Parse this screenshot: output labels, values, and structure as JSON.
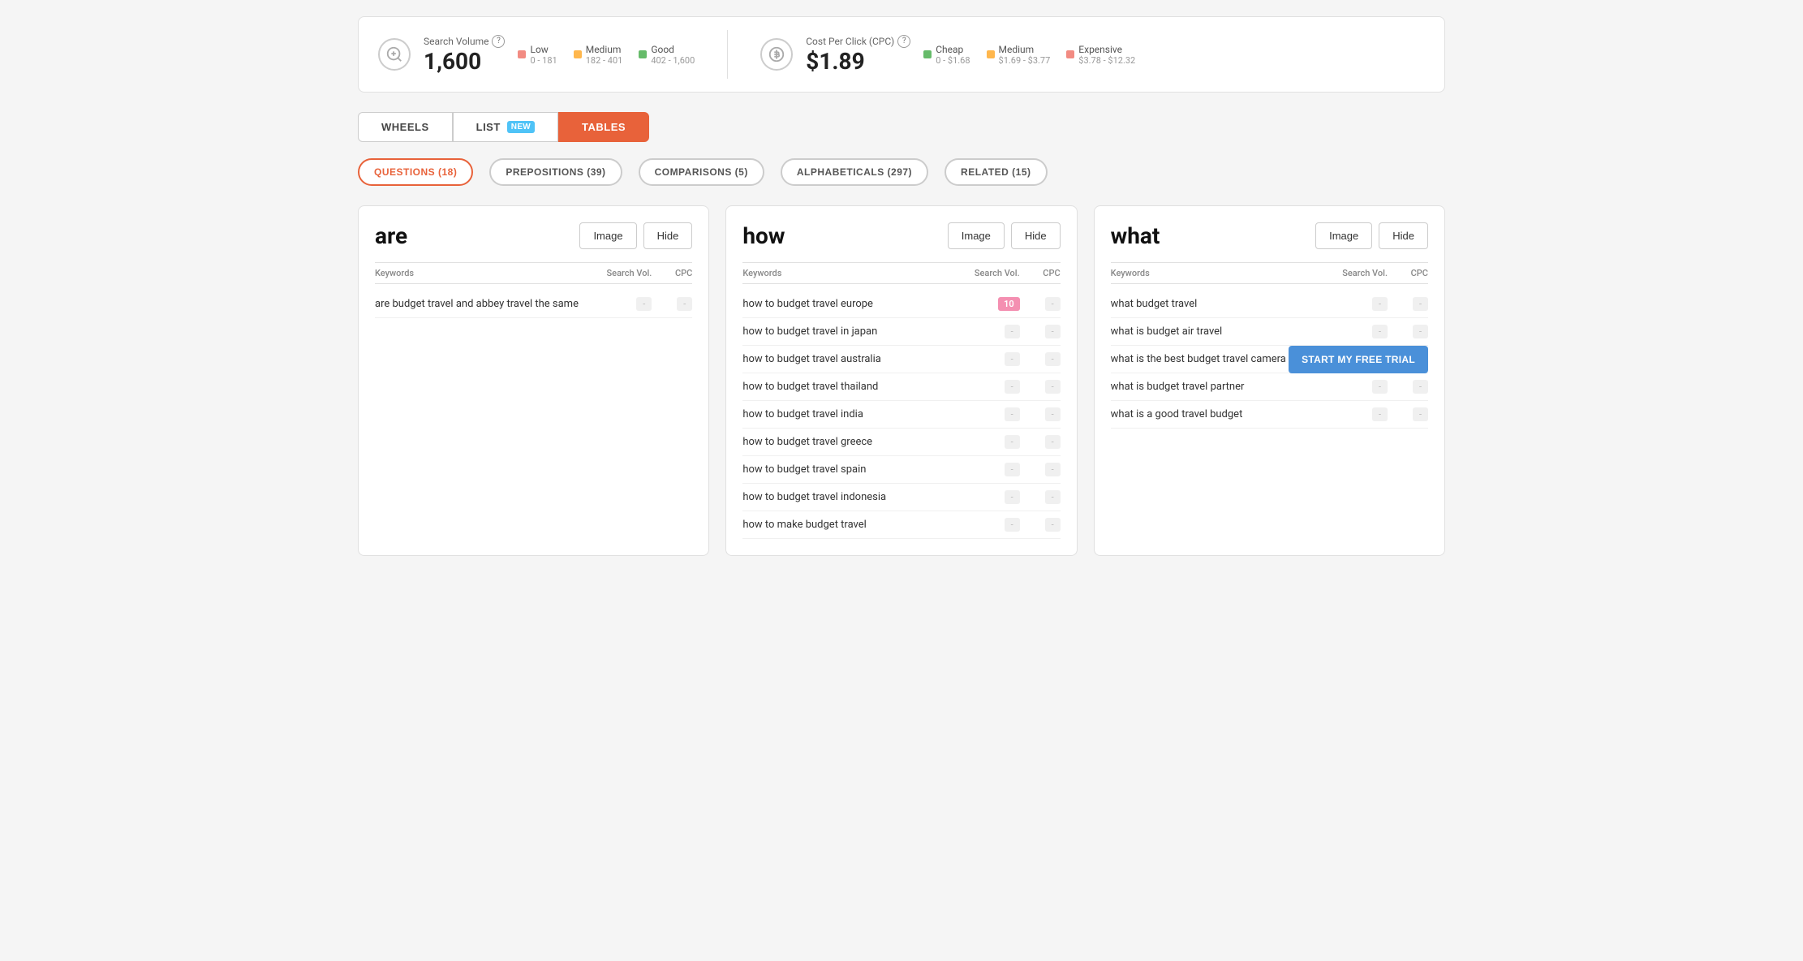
{
  "stats": {
    "searchVolume": {
      "label": "Search Volume",
      "value": "1,600",
      "legend": [
        {
          "color": "#f28b82",
          "label": "Low",
          "range": "0 - 181"
        },
        {
          "color": "#ffb74d",
          "label": "Medium",
          "range": "182 - 401"
        },
        {
          "color": "#66bb6a",
          "label": "Good",
          "range": "402 - 1,600"
        }
      ]
    },
    "cpc": {
      "label": "Cost Per Click (CPC)",
      "value": "$1.89",
      "legend": [
        {
          "color": "#66bb6a",
          "label": "Cheap",
          "range": "0 - $1.68"
        },
        {
          "color": "#ffb74d",
          "label": "Medium",
          "range": "$1.69 - $3.77"
        },
        {
          "color": "#f28b82",
          "label": "Expensive",
          "range": "$3.78 - $12.32"
        }
      ]
    }
  },
  "tabs": [
    {
      "label": "WHEELS",
      "active": false,
      "badge": null
    },
    {
      "label": "LIST",
      "active": false,
      "badge": "NEW"
    },
    {
      "label": "TABLES",
      "active": true,
      "badge": null
    }
  ],
  "filterTabs": [
    {
      "label": "QUESTIONS (18)",
      "active": true
    },
    {
      "label": "PREPOSITIONS (39)",
      "active": false
    },
    {
      "label": "COMPARISONS (5)",
      "active": false
    },
    {
      "label": "ALPHABETICALS (297)",
      "active": false
    },
    {
      "label": "RELATED (15)",
      "active": false
    }
  ],
  "cards": [
    {
      "word": "are",
      "imageLabel": "Image",
      "hideLabel": "Hide",
      "columns": [
        "Keywords",
        "Search Vol.",
        "CPC"
      ],
      "rows": [
        {
          "keyword": "are budget travel and abbey travel the same",
          "vol": "-",
          "cpc": "-",
          "volBadge": false
        }
      ]
    },
    {
      "word": "how",
      "imageLabel": "Image",
      "hideLabel": "Hide",
      "columns": [
        "Keywords",
        "Search Vol.",
        "CPC"
      ],
      "rows": [
        {
          "keyword": "how to budget travel europe",
          "vol": "10",
          "cpc": "-",
          "volBadge": true
        },
        {
          "keyword": "how to budget travel in japan",
          "vol": "-",
          "cpc": "-",
          "volBadge": false
        },
        {
          "keyword": "how to budget travel australia",
          "vol": "-",
          "cpc": "-",
          "volBadge": false
        },
        {
          "keyword": "how to budget travel thailand",
          "vol": "-",
          "cpc": "-",
          "volBadge": false
        },
        {
          "keyword": "how to budget travel india",
          "vol": "-",
          "cpc": "-",
          "volBadge": false
        },
        {
          "keyword": "how to budget travel greece",
          "vol": "-",
          "cpc": "-",
          "volBadge": false
        },
        {
          "keyword": "how to budget travel spain",
          "vol": "-",
          "cpc": "-",
          "volBadge": false
        },
        {
          "keyword": "how to budget travel indonesia",
          "vol": "-",
          "cpc": "-",
          "volBadge": false
        },
        {
          "keyword": "how to make budget travel",
          "vol": "-",
          "cpc": "-",
          "volBadge": false
        }
      ]
    },
    {
      "word": "what",
      "imageLabel": "Image",
      "hideLabel": "Hide",
      "columns": [
        "Keywords",
        "Search Vol.",
        "CPC"
      ],
      "rows": [
        {
          "keyword": "what budget travel",
          "vol": "-",
          "cpc": "-",
          "volBadge": false,
          "hasCta": false
        },
        {
          "keyword": "what is budget air travel",
          "vol": "-",
          "cpc": "-",
          "volBadge": false,
          "hasCta": false
        },
        {
          "keyword": "what is the best budget travel camera",
          "vol": "-",
          "cpc": "-",
          "volBadge": false,
          "hasCta": true
        },
        {
          "keyword": "what is budget travel partner",
          "vol": "-",
          "cpc": "-",
          "volBadge": false,
          "hasCta": false
        },
        {
          "keyword": "what is a good travel budget",
          "vol": "-",
          "cpc": "-",
          "volBadge": false,
          "hasCta": false
        }
      ]
    }
  ],
  "ctaButton": "START MY FREE TRIAL"
}
